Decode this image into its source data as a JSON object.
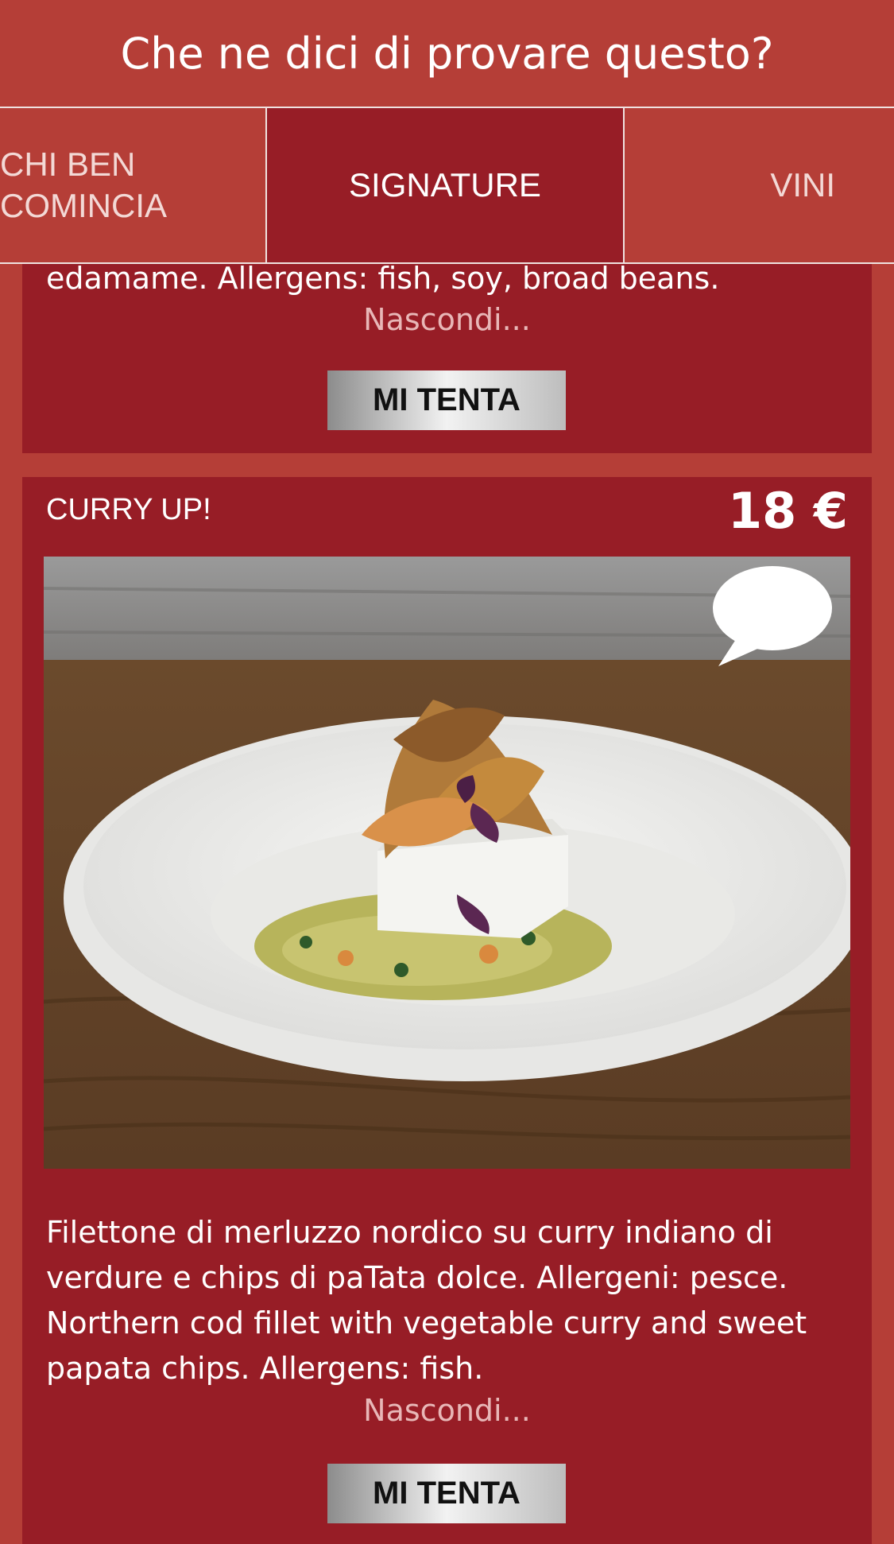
{
  "header": {
    "title": "Che ne dici di provare questo?"
  },
  "tabs": [
    {
      "label": "CHI BEN\nCOMINCIA"
    },
    {
      "label": "SIGNATURE"
    },
    {
      "label": "VINI"
    }
  ],
  "previous_item": {
    "description_tail": "edamame. Allergens: fish, soy, broad beans.",
    "hide_label": "Nascondi...",
    "button_label": "MI TENTA"
  },
  "item": {
    "title": "CURRY UP!",
    "price": "18 €",
    "description": "Filettone di merluzzo nordico su curry indiano di verdure e chips di paTata dolce. Allergeni: pesce. Northern cod fillet with vegetable curry and sweet papata chips. Allergens: fish.",
    "hide_label": "Nascondi...",
    "button_label": "MI TENTA",
    "comment_icon": "speech-bubble-icon"
  },
  "colors": {
    "background": "#b53e37",
    "card": "#971d26",
    "active_tab": "#971d26"
  }
}
